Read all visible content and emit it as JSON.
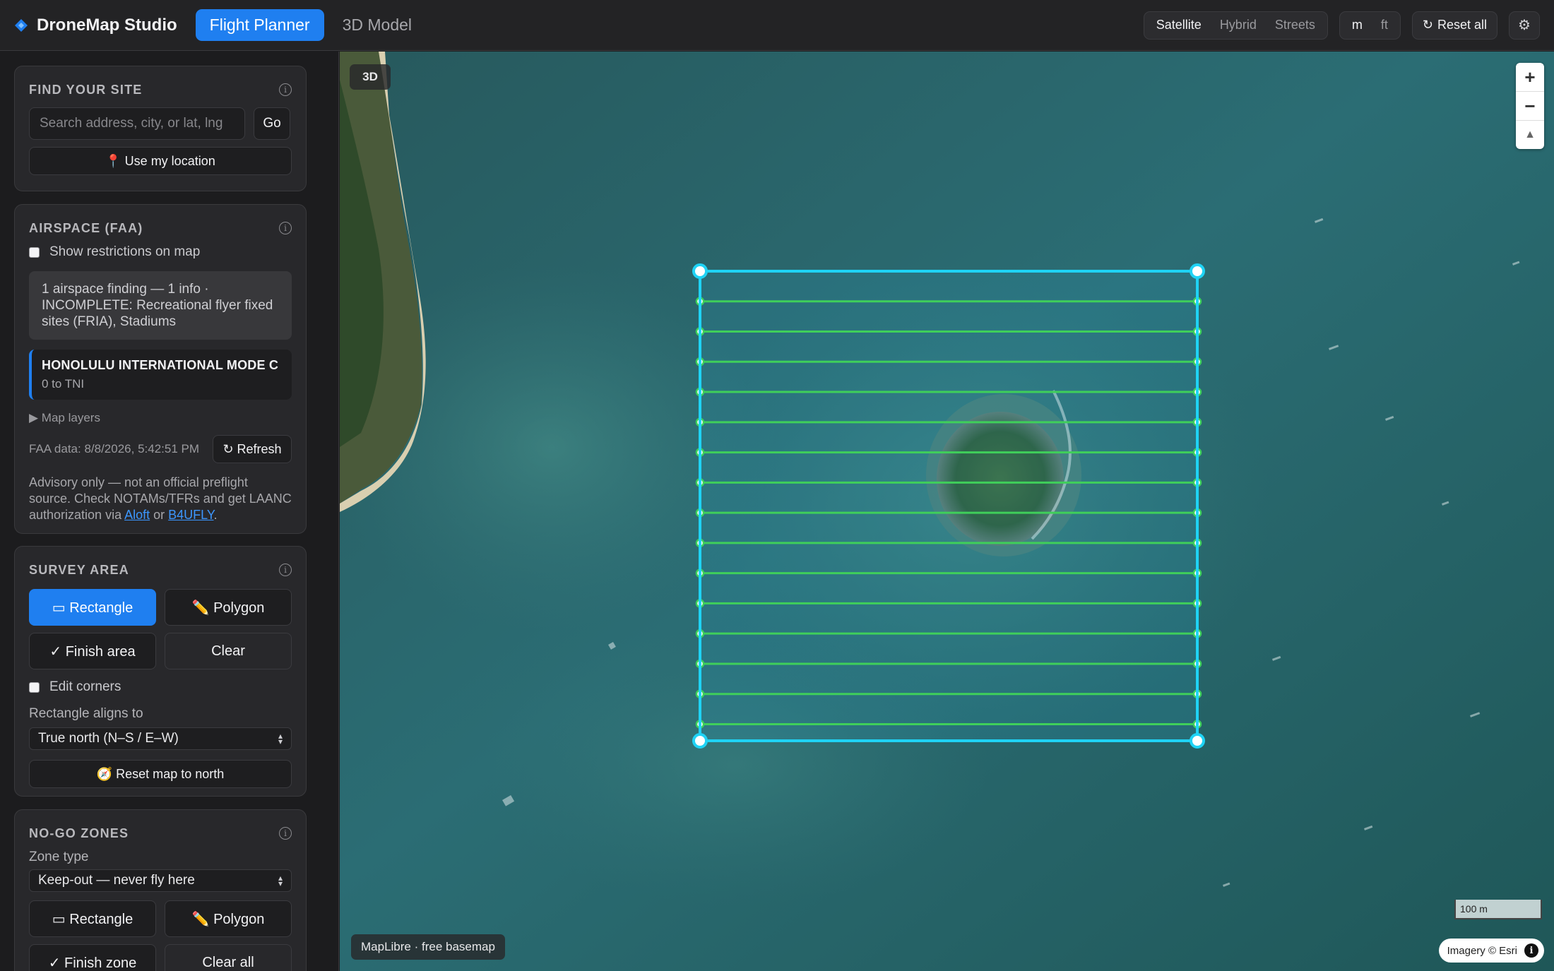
{
  "app": {
    "title": "DroneMap Studio",
    "tabs": [
      {
        "label": "Flight Planner",
        "active": true
      },
      {
        "label": "3D Model",
        "active": false
      }
    ]
  },
  "header": {
    "basemaps": [
      "Satellite",
      "Hybrid",
      "Streets"
    ],
    "basemap_selected": "Satellite",
    "units": [
      "m",
      "ft"
    ],
    "reset_label": "Reset all",
    "reset_icon": "↻",
    "settings_icon": "⚙"
  },
  "find_site": {
    "title": "FIND YOUR SITE",
    "search_placeholder": "Search address, city, or lat, lng",
    "go_label": "Go",
    "location_label": "📍 Use my location"
  },
  "airspace": {
    "title": "AIRSPACE (FAA)",
    "show_restrictions_label": "Show restrictions on map",
    "show_restrictions_checked": false,
    "finding_text": "1 airspace finding — 1 info · INCOMPLETE: Recreational flyer fixed sites (FRIA), Stadiums",
    "card_title": "HONOLULU INTERNATIONAL MODE C",
    "card_sub": "0 to TNI",
    "map_layers_label": "▶ Map layers",
    "faa_data_label": "FAA data: 8/8/2026, 5:42:51 PM",
    "refresh_label": "↻ Refresh",
    "advisory_prefix": "Advisory only — not an official preflight source. Check NOTAMs/TFRs and get LAANC authorization via ",
    "advisory_link1": "Aloft",
    "advisory_mid": " or ",
    "advisory_link2": "B4UFLY",
    "advisory_suffix": "."
  },
  "survey": {
    "title": "SURVEY AREA",
    "rectangle_label": "▭ Rectangle",
    "polygon_label": "✏️ Polygon",
    "finish_label": "✓ Finish area",
    "clear_label": "Clear",
    "edit_corners_label": "Edit corners",
    "edit_corners_checked": false,
    "aligns_label": "Rectangle aligns to",
    "aligns_value": "True north (N–S / E–W)",
    "reset_north_label": "🧭 Reset map to north"
  },
  "nogo": {
    "title": "NO-GO ZONES",
    "zone_type_label": "Zone type",
    "zone_type_value": "Keep-out — never fly here",
    "rectangle_label": "▭ Rectangle",
    "polygon_label": "✏️ Polygon",
    "finish_label": "✓ Finish zone",
    "clear_all_label": "Clear all"
  },
  "map": {
    "mode_label": "3D",
    "zoom_in": "+",
    "zoom_out": "−",
    "compass": "▲",
    "scale_label": "100 m",
    "basemap_note": "MapLibre · free basemap",
    "attribution": "Imagery © Esri",
    "attribution_icon": "i",
    "flight_lines_count": 15,
    "colors": {
      "survey_outline": "#1fd3f5",
      "flight_lines": "#3fcf5a",
      "water": "#2a6f78"
    }
  }
}
